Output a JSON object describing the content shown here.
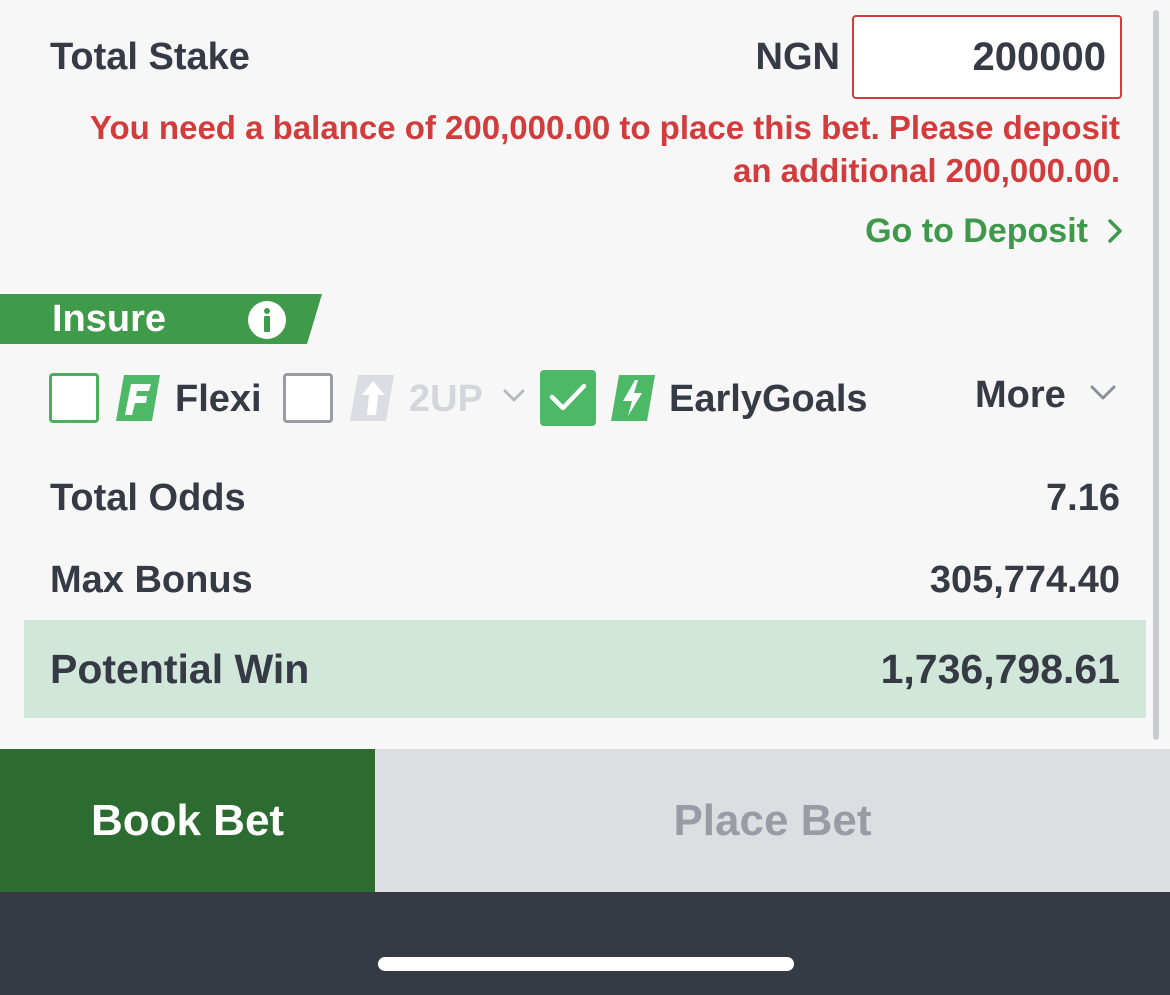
{
  "stake": {
    "label": "Total Stake",
    "currency": "NGN",
    "value": "200000"
  },
  "error": {
    "message": "You need a balance of 200,000.00 to place this bet. Please deposit an additional 200,000.00."
  },
  "deposit": {
    "label": "Go to Deposit",
    "icon": "chevron-right-icon"
  },
  "insure": {
    "label": "Insure",
    "icon": "info-icon",
    "color": "#3f9a4a"
  },
  "options": {
    "flexi": {
      "label": "Flexi",
      "checked": false,
      "icon": "flexi-icon"
    },
    "two_up": {
      "label": "2UP",
      "checked": false,
      "enabled": false,
      "icon": "2up-arrow-icon"
    },
    "early_goals": {
      "label": "EarlyGoals",
      "checked": true,
      "icon": "lightning-icon"
    },
    "more": {
      "label": "More",
      "icon": "chevron-down-icon"
    }
  },
  "summary": {
    "total_odds_label": "Total Odds",
    "total_odds_value": "7.16",
    "max_bonus_label": "Max Bonus",
    "max_bonus_value": "305,774.40",
    "potential_win_label": "Potential Win",
    "potential_win_value": "1,736,798.61"
  },
  "buttons": {
    "book_bet": "Book Bet",
    "place_bet": "Place Bet"
  },
  "colors": {
    "error": "#d33c3c",
    "link_green": "#3e9a4a",
    "book_bet_bg": "#2d6c31",
    "win_band": "#d1e7d9",
    "text_dark": "#353a45"
  }
}
